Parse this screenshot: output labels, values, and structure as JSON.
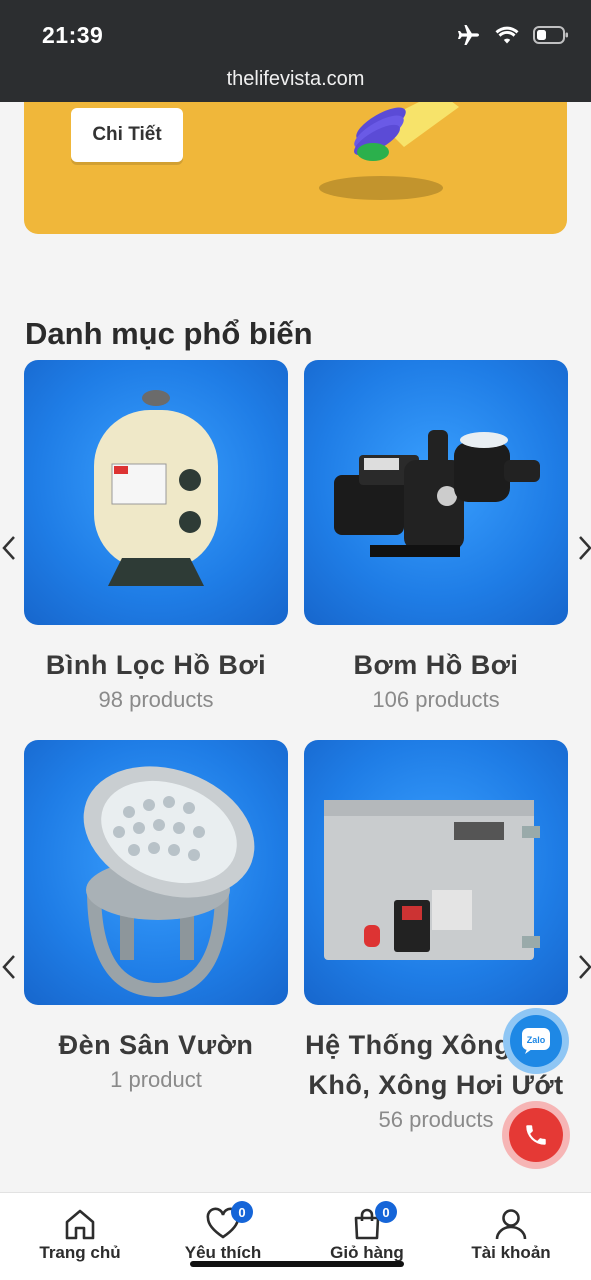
{
  "status_bar": {
    "time": "21:39",
    "url": "thelifevista.com"
  },
  "banner": {
    "button_label": "Chi Tiết"
  },
  "section": {
    "title": "Danh mục phổ biến"
  },
  "categories": [
    {
      "title": "Bình Lọc Hồ Bơi",
      "count": "98 products"
    },
    {
      "title": "Bơm Hồ Bơi",
      "count": "106 products"
    },
    {
      "title": "Đèn Sân Vườn",
      "count": "1 product"
    },
    {
      "title": "Hệ Thống Xông Hơi Khô, Xông Hơi Ướt",
      "count": "56 products"
    }
  ],
  "floating": {
    "zalo_label": "Zalo"
  },
  "bottom_nav": [
    {
      "label": "Trang chủ",
      "icon": "home-icon"
    },
    {
      "label": "Yêu thích",
      "icon": "heart-icon",
      "badge": "0"
    },
    {
      "label": "Giỏ hàng",
      "icon": "bag-icon",
      "badge": "0"
    },
    {
      "label": "Tài khoản",
      "icon": "user-icon"
    }
  ],
  "colors": {
    "banner": "#f0b73a",
    "card_bg": "#1f7de6",
    "badge": "#1565d8",
    "phone": "#e53935",
    "zalo": "#1e88e5"
  }
}
